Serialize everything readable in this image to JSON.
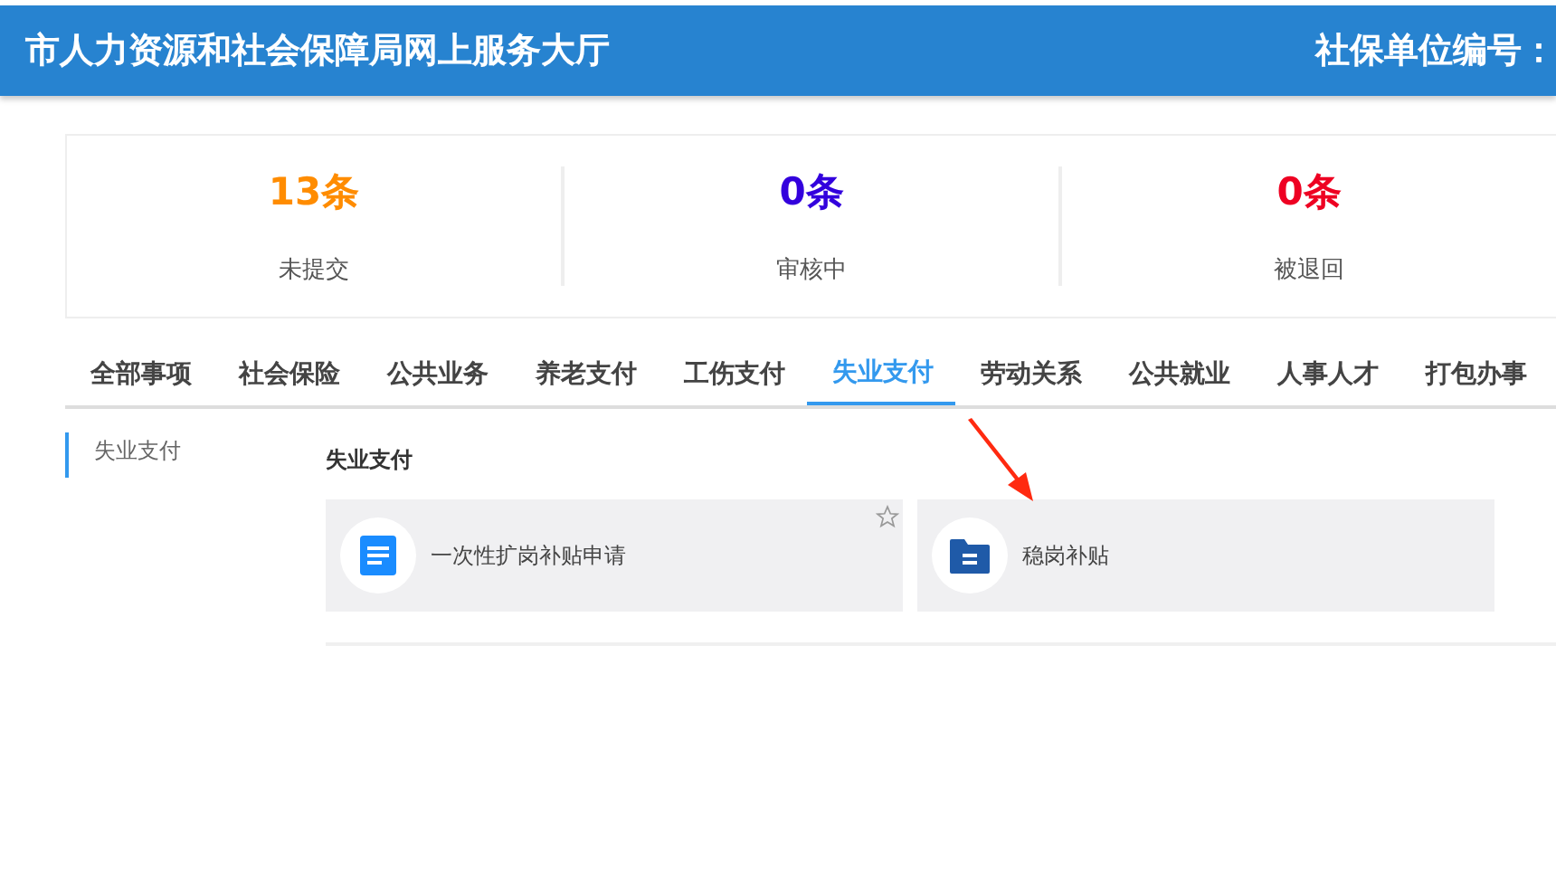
{
  "header": {
    "title": "市人力资源和社会保障局网上服务大厅",
    "unit_label": "社保单位编号："
  },
  "stats": [
    {
      "count": "13条",
      "label": "未提交",
      "color": "#ff8c00"
    },
    {
      "count": "0条",
      "label": "审核中",
      "color": "#3300dd"
    },
    {
      "count": "0条",
      "label": "被退回",
      "color": "#ee0022"
    }
  ],
  "tabs": [
    {
      "label": "全部事项",
      "selected": false
    },
    {
      "label": "社会保险",
      "selected": false
    },
    {
      "label": "公共业务",
      "selected": false
    },
    {
      "label": "养老支付",
      "selected": false
    },
    {
      "label": "工伤支付",
      "selected": false
    },
    {
      "label": "失业支付",
      "selected": true
    },
    {
      "label": "劳动关系",
      "selected": false
    },
    {
      "label": "公共就业",
      "selected": false
    },
    {
      "label": "人事人才",
      "selected": false
    },
    {
      "label": "打包办事",
      "selected": false
    }
  ],
  "sidebar": {
    "items": [
      {
        "label": "失业支付",
        "selected": true
      }
    ]
  },
  "section": {
    "title": "失业支付",
    "services": [
      {
        "name": "一次性扩岗补贴申请",
        "kind": "document",
        "starrable": true
      },
      {
        "name": "稳岗补贴",
        "kind": "folder",
        "starrable": false
      }
    ]
  }
}
